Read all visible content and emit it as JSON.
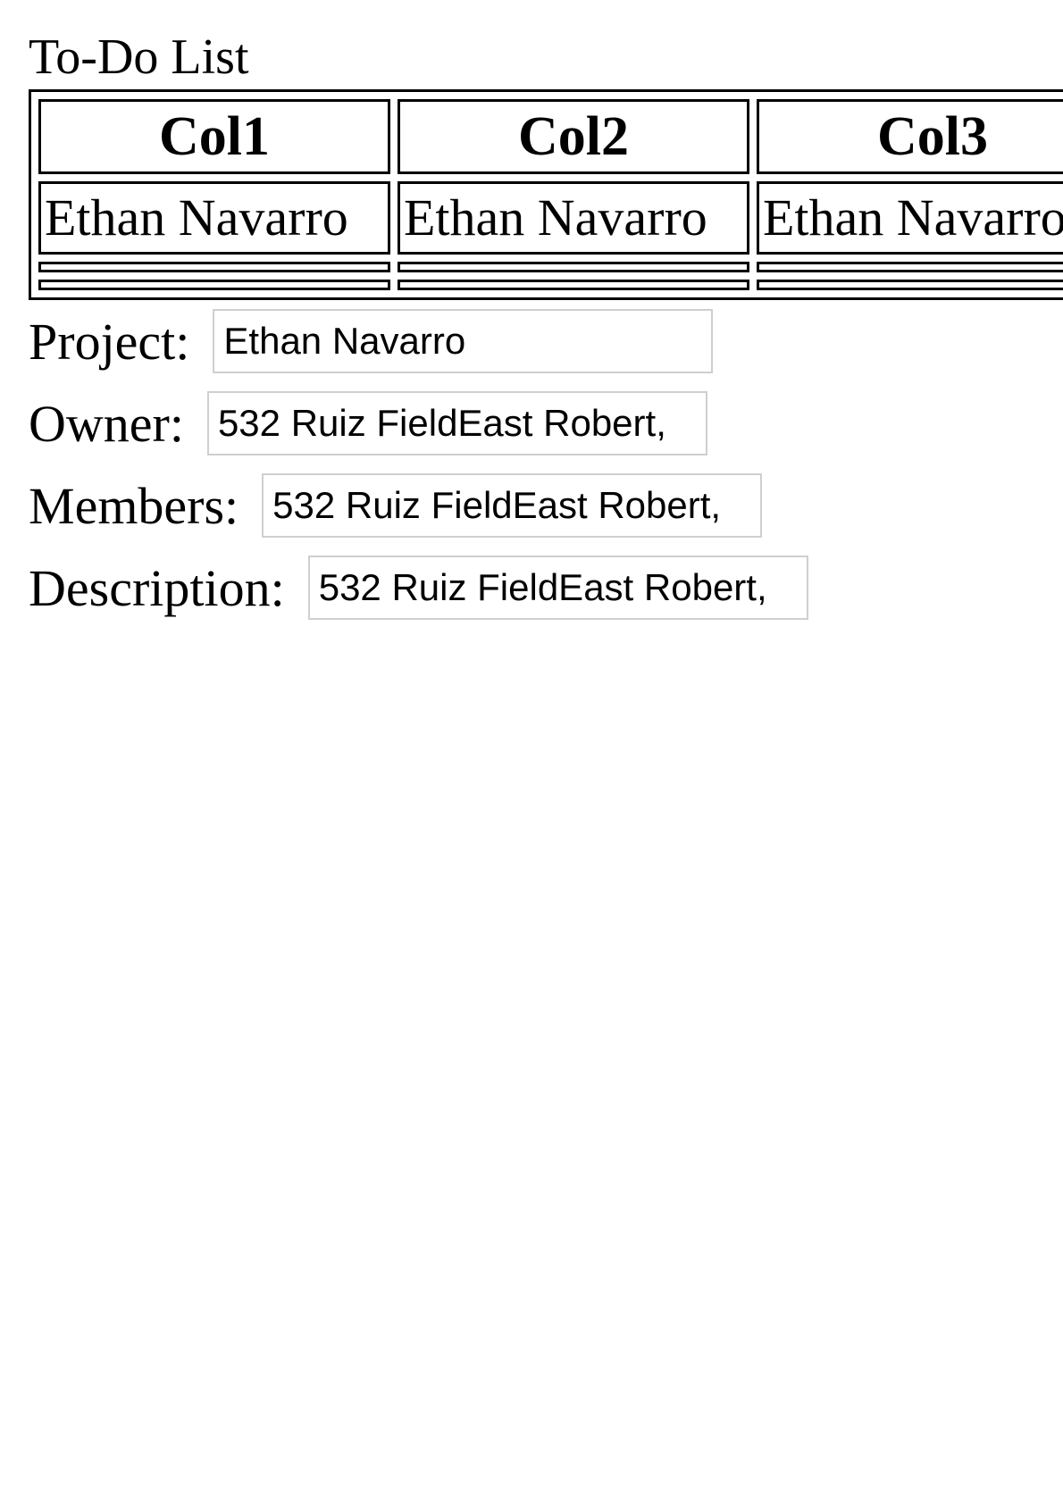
{
  "page": {
    "title": "To-Do List"
  },
  "table": {
    "headers": [
      "Col1",
      "Col2",
      "Col3"
    ],
    "rows": [
      [
        "Ethan Navarro",
        "Ethan Navarro",
        "Ethan Navarro"
      ],
      [
        "",
        "",
        ""
      ],
      [
        "",
        "",
        ""
      ]
    ]
  },
  "form": {
    "project": {
      "label": "Project:",
      "value": "Ethan Navarro"
    },
    "owner": {
      "label": "Owner:",
      "value": "532 Ruiz FieldEast Robert,"
    },
    "members": {
      "label": "Members:",
      "value": "532 Ruiz FieldEast Robert,"
    },
    "description": {
      "label": "Description:",
      "value": "532 Ruiz FieldEast Robert,"
    }
  }
}
